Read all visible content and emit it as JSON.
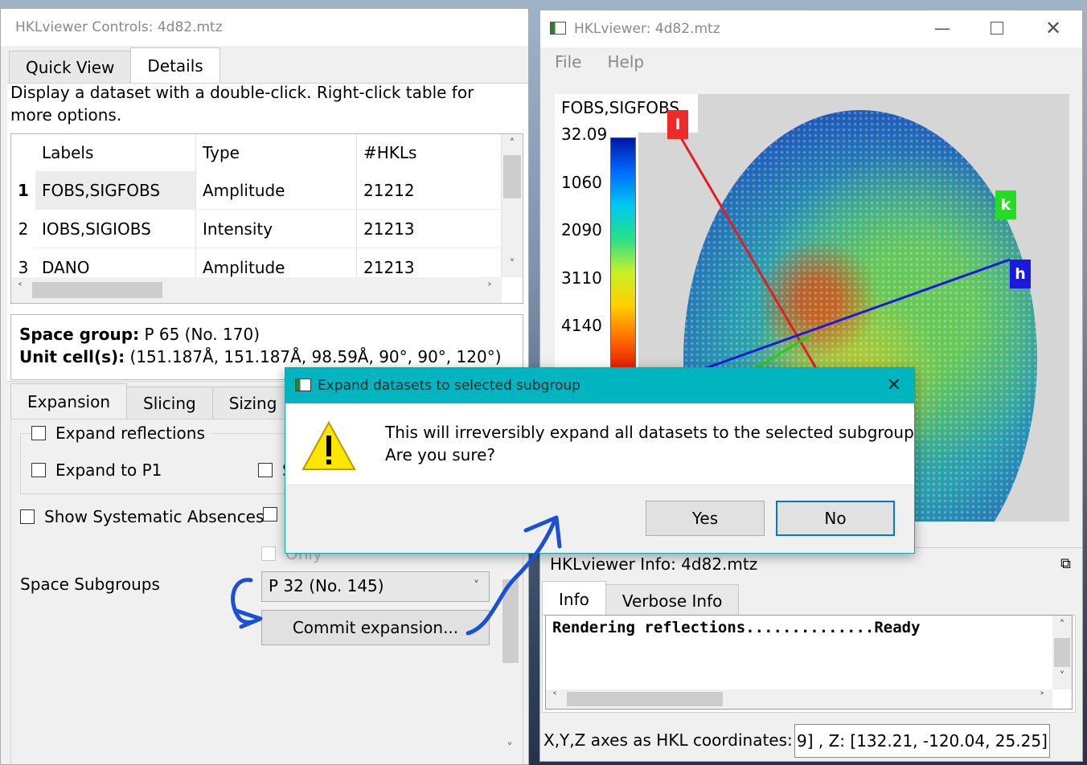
{
  "controls": {
    "title": "HKLviewer Controls: 4d82.mtz",
    "tabs": [
      "Quick View",
      "Details"
    ],
    "hint": "Display a dataset with a double-click. Right-click table for more options.",
    "table": {
      "headers": [
        "Labels",
        "Type",
        "#HKLs"
      ],
      "rows": [
        {
          "num": "1",
          "label": "FOBS,SIGFOBS",
          "type": "Amplitude",
          "hkls": "21212"
        },
        {
          "num": "2",
          "label": "IOBS,SIGIOBS",
          "type": "Intensity",
          "hkls": "21213"
        },
        {
          "num": "3",
          "label": "DANO",
          "type": "Amplitude",
          "hkls": "21213"
        }
      ]
    },
    "space_group_label": "Space group:",
    "space_group_value": "P 65 (No. 170)",
    "unit_cell_label": "Unit cell(s):",
    "unit_cell_value": "(151.187Å, 151.187Å, 98.59Å, 90°, 90°, 120°)",
    "subtabs": [
      "Expansion",
      "Slicing",
      "Sizing"
    ],
    "expand_reflections": "Expand reflections",
    "expand_to_p1": "Expand to P1",
    "expand_partial": "S",
    "show_sys_absences": "Show Systematic Absences",
    "only_label": "Only",
    "space_subgroups_label": "Space Subgroups",
    "subgroup_value": "P 32 (No. 145)",
    "commit_button": "Commit expansion..."
  },
  "viewer": {
    "title": "HKLviewer: 4d82.mtz",
    "menu": [
      "File",
      "Help"
    ],
    "dataset_label": "FOBS,SIGFOBS",
    "colorbar_ticks": [
      "32.09",
      "1060",
      "2090",
      "3110",
      "4140"
    ],
    "axes": {
      "l": "l",
      "k": "k",
      "h": "h"
    },
    "info_title": "HKLviewer Info: 4d82.mtz",
    "info_tabs": [
      "Info",
      "Verbose Info"
    ],
    "log_text": "Rendering reflections..............Ready",
    "coord_label": "X,Y,Z axes as HKL coordinates:",
    "coord_value": "9] , Z: [132.21, -120.04, 25.25]"
  },
  "dialog": {
    "title": "Expand datasets to selected subgroup",
    "line1": "This will irreversibly expand all datasets to the selected subgroup",
    "line2": "Are you sure?",
    "yes": "Yes",
    "no": "No"
  },
  "colors": {
    "dialog_title_bar": "#00b4c0",
    "axis_l": "#e02020",
    "axis_k": "#22cc22",
    "axis_h": "#1a1adf",
    "annotation_ink": "#1a4fd6"
  }
}
